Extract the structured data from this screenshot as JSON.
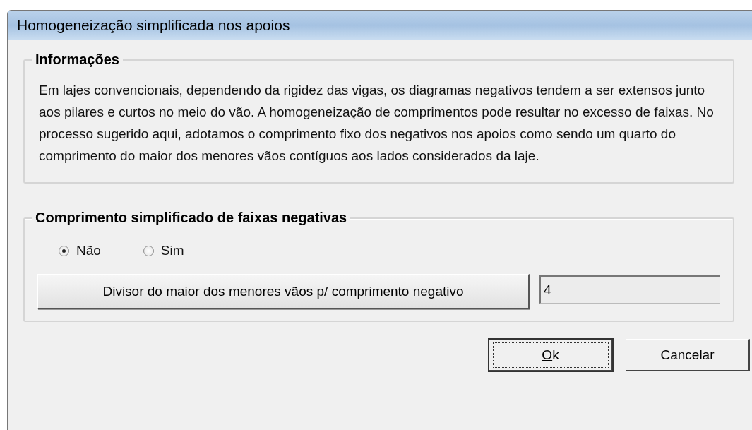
{
  "window": {
    "title": "Homogeneização simplificada nos apoios"
  },
  "info_group": {
    "title": "Informações",
    "text": "Em lajes convencionais, dependendo da rigidez das vigas, os diagramas negativos tendem a ser extensos junto aos pilares e curtos no meio do vão. A homogeneização de comprimentos pode resultar no excesso de faixas. No processo sugerido aqui, adotamos o comprimento fixo dos negativos nos apoios como sendo um quarto do comprimento do maior dos menores vãos contíguos aos lados considerados da laje."
  },
  "length_group": {
    "title": "Comprimento simplificado de faixas negativas",
    "options": [
      {
        "label": "Não",
        "selected": true
      },
      {
        "label": "Sim",
        "selected": false
      }
    ],
    "divisor_button": "Divisor do maior dos menores vãos p/ comprimento negativo",
    "divisor_value": "4"
  },
  "buttons": [
    {
      "label": "Ok",
      "focused": true
    },
    {
      "label": "Cancelar",
      "focused": false
    }
  ]
}
